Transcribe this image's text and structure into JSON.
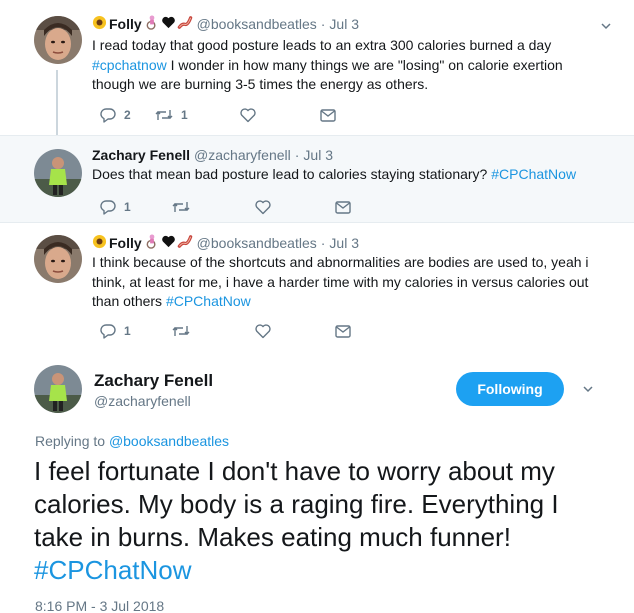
{
  "tweets": [
    {
      "name": "Folly",
      "emojis": [
        "sunflower",
        "woman-wheelchair",
        "black-heart",
        "bacon"
      ],
      "handle": "@booksandbeatles",
      "time": "Jul 3",
      "text": "I read today that good posture leads to an extra 300 calories burned a day",
      "hashtag": "#cpchatnow",
      "text_after": " I wonder in how many things we are \"losing\" on calorie exertion though we are burning 3-5 times the energy as others.",
      "replies": "2",
      "retweets": "1"
    },
    {
      "name": "Zachary Fenell",
      "handle": "@zacharyfenell",
      "time": "Jul 3",
      "text": "Does that mean bad posture lead to calories staying stationary? ",
      "hashtag": "#CPChatNow",
      "replies": "1",
      "retweets": ""
    },
    {
      "name": "Folly",
      "emojis": [
        "sunflower",
        "woman-wheelchair",
        "black-heart",
        "bacon"
      ],
      "handle": "@booksandbeatles",
      "time": "Jul 3",
      "text": "I think because of the shortcuts and abnormalities are bodies are used to, yeah i think, at least for me, i have a harder time with my calories in versus calories out than others ",
      "hashtag": "#CPChatNow",
      "replies": "1",
      "retweets": ""
    }
  ],
  "focused": {
    "name": "Zachary Fenell",
    "handle": "@zacharyfenell",
    "follow_label": "Following",
    "replying_prefix": "Replying to ",
    "replying_to": "@booksandbeatles",
    "text": "I feel fortunate I don't have to worry about my calories. My body is a raging fire. Everything I take in burns. Makes eating much funner! ",
    "hashtag": "#CPChatNow",
    "timestamp": "8:16 PM - 3 Jul 2018"
  },
  "colors": {
    "accent": "#1da1f2",
    "link": "#1b95e0",
    "muted": "#657786",
    "highlight_bg": "#f5f8fa"
  },
  "dot": "·"
}
